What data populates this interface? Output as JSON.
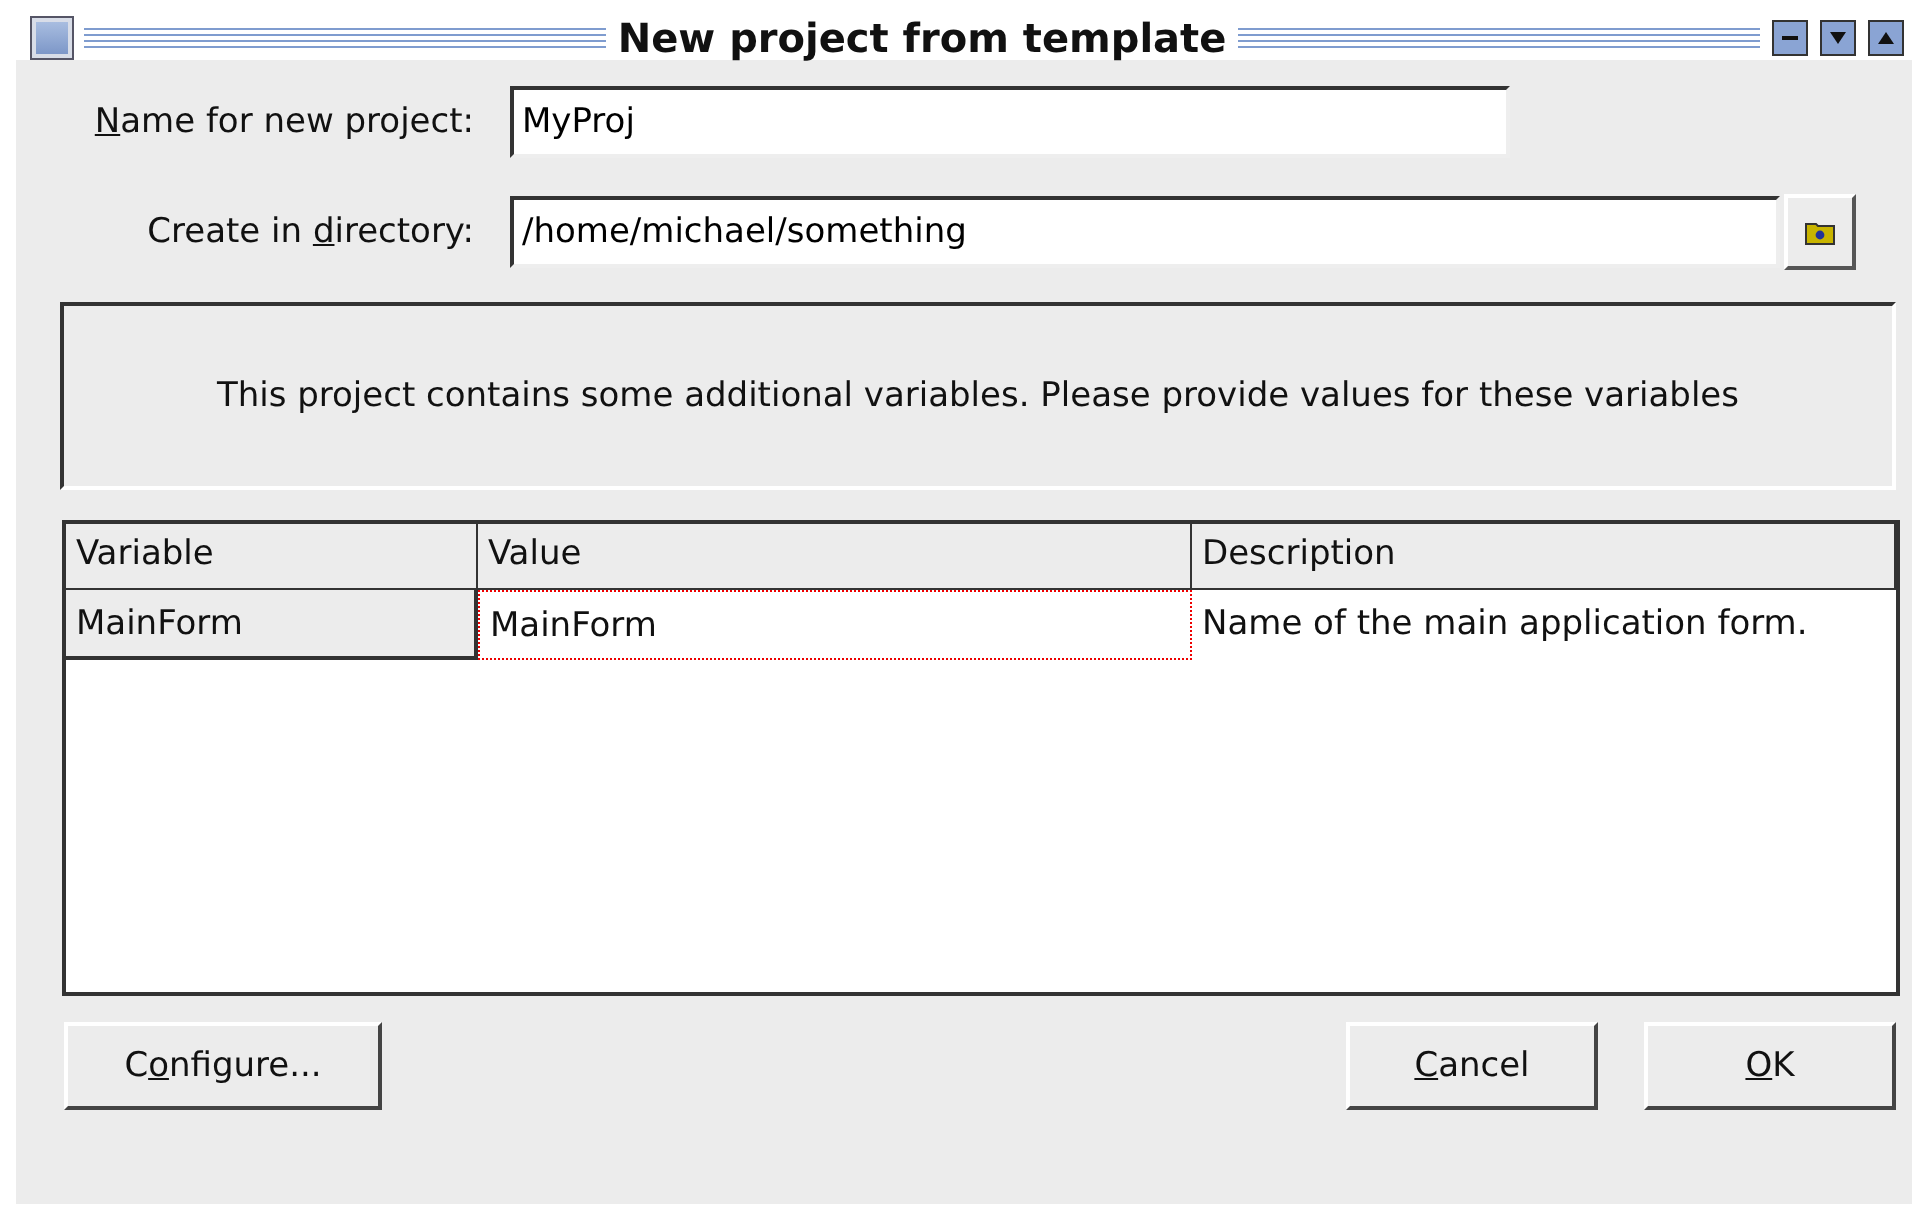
{
  "window": {
    "title": "New project from template"
  },
  "fields": [
    {
      "label": {
        "key": "N",
        "after": "ame for new project:"
      },
      "value": "MyProj",
      "kind": "text"
    },
    {
      "label": {
        "before": "Create in ",
        "key": "d",
        "after": "irectory:"
      },
      "value": "/home/michael/something",
      "kind": "browse"
    }
  ],
  "info": "This project contains some additional variables. Please provide values for these variables",
  "table": {
    "columns": [
      "Variable",
      "Value",
      "Description"
    ],
    "rows": [
      {
        "cells": [
          {
            "text": "MainForm",
            "focused": false
          },
          {
            "text": "MainForm",
            "focused": true
          },
          {
            "text": "Name of the main application form.",
            "focused": false
          }
        ]
      }
    ]
  },
  "left_buttons": [
    {
      "before": "C",
      "key": "o",
      "after": "nfigure..."
    }
  ],
  "right_buttons": [
    {
      "key": "C",
      "after": "ancel"
    },
    {
      "key": "O",
      "after": "K"
    }
  ]
}
